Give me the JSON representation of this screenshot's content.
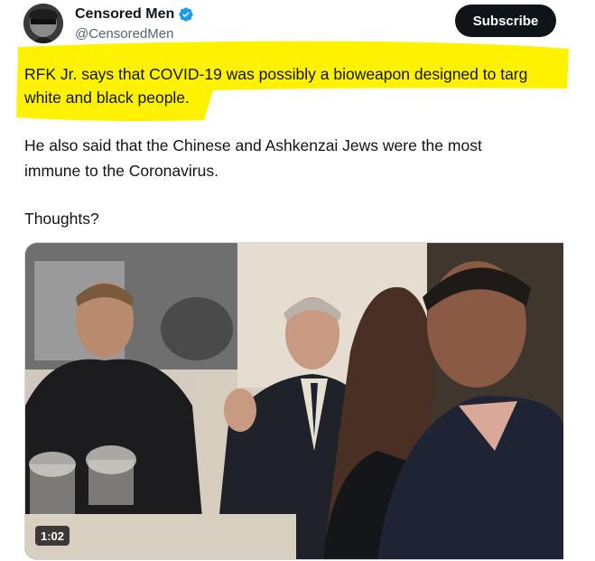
{
  "author": {
    "display_name": "Censored Men",
    "handle": "@CensoredMen",
    "avatar_label": "CENSORED",
    "verified_icon": "verified-badge-icon",
    "verified_color": "#1d9bf0"
  },
  "subscribe_label": "Subscribe",
  "tweet": {
    "line1": "RFK Jr. says that COVID-19 was possibly a bioweapon designed to targ",
    "line2": "white and black people.",
    "line3": "He also said that the Chinese and Ashkenzai Jews were the most",
    "line4": "immune to the Coronavirus.",
    "line5": "Thoughts?"
  },
  "media": {
    "type": "video",
    "duration": "1:02"
  },
  "colors": {
    "highlight": "#fef200",
    "text": "#0f1419",
    "secondary": "#536471",
    "button_bg": "#0f1419"
  }
}
